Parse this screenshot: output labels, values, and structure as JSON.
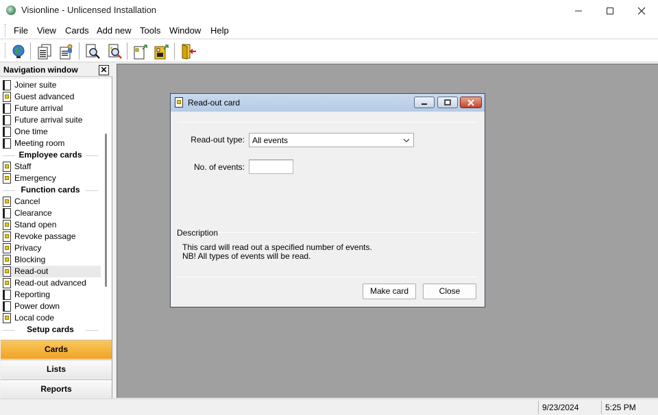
{
  "window": {
    "title": "Visionline - Unlicensed Installation"
  },
  "menu": [
    "File",
    "View",
    "Cards",
    "Add new",
    "Tools",
    "Window",
    "Help"
  ],
  "toolbar": [
    "globe-icon",
    "card-list-icon",
    "card-user-icon",
    "search-card-icon",
    "search-page-icon",
    "new-card-icon",
    "encode-card-icon",
    "logout-door-icon"
  ],
  "navigation": {
    "title": "Navigation window",
    "items": [
      {
        "type": "item",
        "label": "Joiner suite",
        "icon": "dark"
      },
      {
        "type": "item",
        "label": "Guest advanced",
        "icon": "yellow"
      },
      {
        "type": "item",
        "label": "Future arrival",
        "icon": "dark"
      },
      {
        "type": "item",
        "label": "Future arrival suite",
        "icon": "dark"
      },
      {
        "type": "item",
        "label": "One time",
        "icon": "dark"
      },
      {
        "type": "item",
        "label": "Meeting room",
        "icon": "dark"
      },
      {
        "type": "group",
        "label": "Employee cards"
      },
      {
        "type": "item",
        "label": "Staff",
        "icon": "yellow"
      },
      {
        "type": "item",
        "label": "Emergency",
        "icon": "yellow"
      },
      {
        "type": "group",
        "label": "Function cards"
      },
      {
        "type": "item",
        "label": "Cancel",
        "icon": "yellow"
      },
      {
        "type": "item",
        "label": "Clearance",
        "icon": "dark"
      },
      {
        "type": "item",
        "label": "Stand open",
        "icon": "yellow"
      },
      {
        "type": "item",
        "label": "Revoke passage",
        "icon": "yellow"
      },
      {
        "type": "item",
        "label": "Privacy",
        "icon": "yellow"
      },
      {
        "type": "item",
        "label": "Blocking",
        "icon": "yellow"
      },
      {
        "type": "item",
        "label": "Read-out",
        "icon": "yellow",
        "selected": true
      },
      {
        "type": "item",
        "label": "Read-out advanced",
        "icon": "yellow"
      },
      {
        "type": "item",
        "label": "Reporting",
        "icon": "dark"
      },
      {
        "type": "item",
        "label": "Power down",
        "icon": "dark"
      },
      {
        "type": "item",
        "label": "Local code",
        "icon": "yellow"
      },
      {
        "type": "group",
        "label": "Setup cards"
      }
    ],
    "bottom": {
      "cards": "Cards",
      "lists": "Lists",
      "reports": "Reports"
    }
  },
  "dialog": {
    "title": "Read-out card",
    "readout_type_label": "Read-out type:",
    "readout_type_value": "All events",
    "events_label": "No. of events:",
    "events_value": "",
    "description_label": "Description",
    "description_line1": "This card will read out a specified number of events.",
    "description_line2": "NB! All types of events will be read.",
    "make_card": "Make card",
    "close": "Close"
  },
  "status": {
    "date": "9/23/2024",
    "time": "5:25 PM"
  },
  "colors": {
    "accent_tab": "#f0a326",
    "dialog_title": "#b5cbe5",
    "close_red": "#c44329"
  }
}
